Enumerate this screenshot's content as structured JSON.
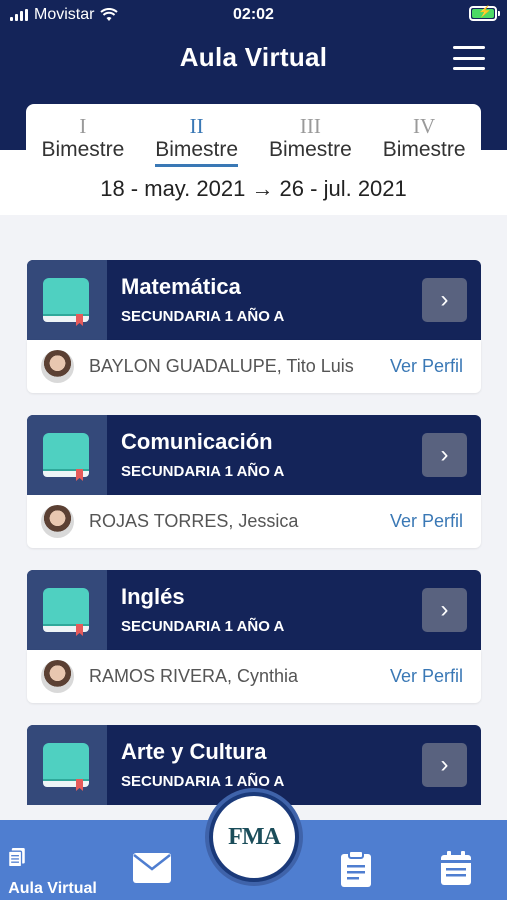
{
  "status_bar": {
    "carrier": "Movistar",
    "time": "02:02"
  },
  "header": {
    "title": "Aula Virtual"
  },
  "tabs": [
    {
      "numeral": "I",
      "label": "Bimestre",
      "active": false
    },
    {
      "numeral": "II",
      "label": "Bimestre",
      "active": true
    },
    {
      "numeral": "III",
      "label": "Bimestre",
      "active": false
    },
    {
      "numeral": "IV",
      "label": "Bimestre",
      "active": false
    }
  ],
  "date_range": "18 - may. 2021 → 26 - jul. 2021",
  "courses": [
    {
      "name": "Matemática",
      "level": "SECUNDARIA 1 AÑO A",
      "teacher": "BAYLON GUADALUPE, Tito Luis",
      "profile_link": "Ver Perfil"
    },
    {
      "name": "Comunicación",
      "level": "SECUNDARIA 1 AÑO A",
      "teacher": "ROJAS TORRES, Jessica",
      "profile_link": "Ver Perfil"
    },
    {
      "name": "Inglés",
      "level": "SECUNDARIA 1 AÑO A",
      "teacher": "RAMOS RIVERA, Cynthia",
      "profile_link": "Ver Perfil"
    },
    {
      "name": "Arte y Cultura",
      "level": "SECUNDARIA 1 AÑO A"
    }
  ],
  "bottom_nav": {
    "home_label": "Aula Virtual",
    "logo_text": "FMA"
  },
  "colors": {
    "primary_dark": "#142459",
    "accent_blue": "#3a78b5",
    "nav_blue": "#4f7ed0",
    "book_teal": "#4fd0c1"
  }
}
